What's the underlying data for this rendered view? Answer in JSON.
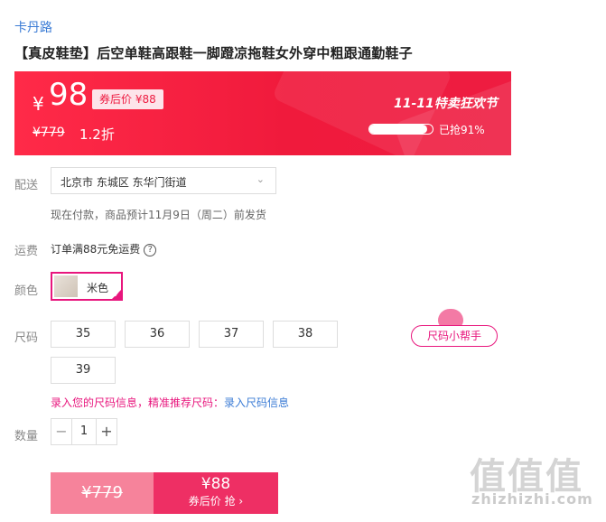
{
  "shop": {
    "name": "卡丹路"
  },
  "product": {
    "title": "【真皮鞋垫】后空单鞋高跟鞋一脚蹬凉拖鞋女外穿中粗跟通勤鞋子"
  },
  "banner": {
    "currency": "¥",
    "price": "98",
    "coupon_price": "券后价 ¥88",
    "original_price": "¥779",
    "discount": "1.2折",
    "festival": "11-11特卖狂欢节",
    "sold_label": "已抢91%",
    "sold_fraction": 0.91,
    "colors": {
      "bg_start": "#ff2a48",
      "bg_end": "#ee1c41"
    }
  },
  "delivery": {
    "label": "配送",
    "address": "北京市 东城区 东华门街道",
    "note": "现在付款，商品预计11月9日（周二）前发货"
  },
  "freight": {
    "label": "运费",
    "text": "订单满88元免运费",
    "help_icon": "?"
  },
  "color": {
    "label": "颜色",
    "option": "米色",
    "accent": "#e8167d"
  },
  "size": {
    "label": "尺码",
    "options": [
      "35",
      "36",
      "37",
      "38",
      "39"
    ],
    "helper": "尺码小帮手",
    "info_prompt": "录入您的尺码信息，精准推荐尺码：",
    "info_link": "录入尺码信息"
  },
  "quantity": {
    "label": "数量",
    "value": "1",
    "minus": "−",
    "plus": "+"
  },
  "buy": {
    "original": "¥779",
    "price": "¥88",
    "sub": "券后价 抢 ›"
  },
  "watermark": {
    "logo": "值值值",
    "site": "zhizhizhi.com"
  }
}
